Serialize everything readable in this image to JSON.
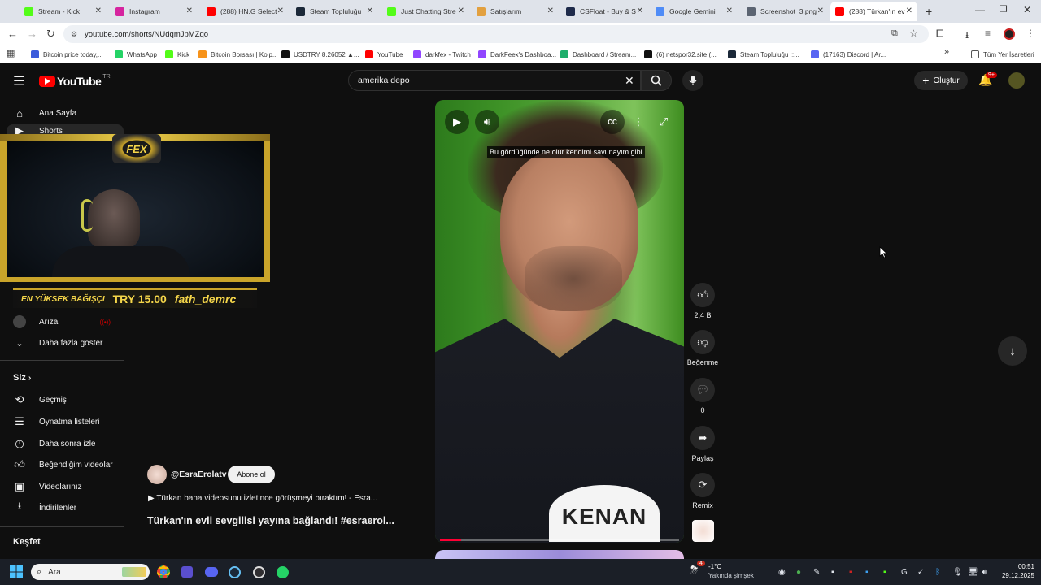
{
  "browser": {
    "tabs": [
      {
        "title": "Stream - Kick",
        "color": "#53fc18"
      },
      {
        "title": "Instagram",
        "color": "#d6249f"
      },
      {
        "title": "(288) HN.G Select",
        "color": "#ff0000"
      },
      {
        "title": "Steam Topluluğu",
        "color": "#1b2838"
      },
      {
        "title": "Just Chatting Stre",
        "color": "#53fc18"
      },
      {
        "title": "Satışlarım",
        "color": "#e2a03f"
      },
      {
        "title": "CSFloat - Buy & S",
        "color": "#1e2a4a"
      },
      {
        "title": "Google Gemini",
        "color": "#4f8cf7"
      },
      {
        "title": "Screenshot_3.png",
        "color": "#5b6472"
      },
      {
        "title": "(288) Türkan'ın ev",
        "color": "#ff0000"
      }
    ],
    "url": "youtube.com/shorts/NUdqmJpMZqo",
    "bookmarks": [
      {
        "label": "Bitcoin price today,...",
        "color": "#3b5bdb"
      },
      {
        "label": "WhatsApp",
        "color": "#25d366"
      },
      {
        "label": "Kick",
        "color": "#53fc18"
      },
      {
        "label": "Bitcoin Borsası | Kolp...",
        "color": "#f7931a"
      },
      {
        "label": "USDTRY 8.26052 ▲...",
        "color": "#111111"
      },
      {
        "label": "YouTube",
        "color": "#ff0000"
      },
      {
        "label": "darkfex - Twitch",
        "color": "#9146ff"
      },
      {
        "label": "DarkFeex's Dashboa...",
        "color": "#9146ff"
      },
      {
        "label": "Dashboard / Stream...",
        "color": "#1fae6b"
      },
      {
        "label": "(6) netspor32.site (...",
        "color": "#111111"
      },
      {
        "label": "Steam Topluluğu ::...",
        "color": "#1b2838"
      },
      {
        "label": "(17163) Discord | Ar...",
        "color": "#5865f2"
      }
    ],
    "all_bookmarks": "Tüm Yer İşaretleri"
  },
  "youtube": {
    "logo": "YouTube",
    "region": "TR",
    "search": {
      "value": "amerika depo"
    },
    "create_label": "Oluştur",
    "notif_count": "9+",
    "sidebar": {
      "home": "Ana Sayfa",
      "shorts": "Shorts",
      "channel_ariza": "Arıza",
      "show_more": "Daha fazla göster",
      "you_header": "Siz",
      "you_items": [
        "Geçmiş",
        "Oynatma listeleri",
        "Daha sonra izle",
        "Beğendiğim videolar",
        "Videolarınız",
        "İndirilenler"
      ],
      "explore_header": "Keşfet"
    },
    "overlay": {
      "badge": "FEX",
      "donation_label": "EN YÜKSEK BAĞIŞÇI",
      "donation_amount": "TRY 15.00",
      "donor": "fath_demrc"
    },
    "short": {
      "caption": "Bu gördüğünde ne olur kendimi savunayım gibi",
      "name_card": "KENAN",
      "channel": "@EsraErolatv",
      "subscribe": "Abone ol",
      "music": "Türkan bana videosunu izletince görüşmeyi bıraktım! - Esra...",
      "title": "Türkan'ın evli sevgilisi yayına bağlandı! #esraerol...",
      "progress": 0.09
    },
    "actions": {
      "likes": "2,4 B",
      "dislike": "Beğenme",
      "comments": "0",
      "share": "Paylaş",
      "remix": "Remix"
    }
  },
  "taskbar": {
    "search_placeholder": "Ara",
    "weather_temp": "-1°C",
    "weather_desc": "Yakında şimşek",
    "weather_badge": "4",
    "time": "00:51",
    "date": "29.12.2025"
  }
}
